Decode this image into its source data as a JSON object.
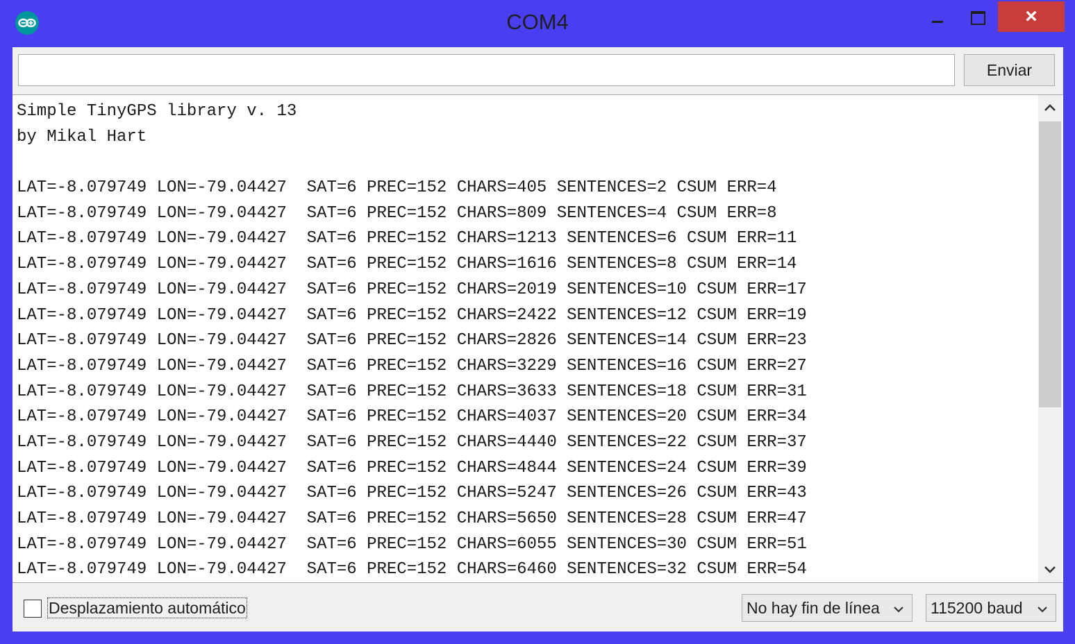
{
  "window": {
    "title": "COM4",
    "close_label": "×"
  },
  "toolbar": {
    "input_value": "",
    "send_label": "Enviar"
  },
  "console": {
    "lines": [
      "Simple TinyGPS library v. 13",
      "by Mikal Hart",
      "",
      "LAT=-8.079749 LON=-79.04427  SAT=6 PREC=152 CHARS=405 SENTENCES=2 CSUM ERR=4",
      "LAT=-8.079749 LON=-79.04427  SAT=6 PREC=152 CHARS=809 SENTENCES=4 CSUM ERR=8",
      "LAT=-8.079749 LON=-79.04427  SAT=6 PREC=152 CHARS=1213 SENTENCES=6 CSUM ERR=11",
      "LAT=-8.079749 LON=-79.04427  SAT=6 PREC=152 CHARS=1616 SENTENCES=8 CSUM ERR=14",
      "LAT=-8.079749 LON=-79.04427  SAT=6 PREC=152 CHARS=2019 SENTENCES=10 CSUM ERR=17",
      "LAT=-8.079749 LON=-79.04427  SAT=6 PREC=152 CHARS=2422 SENTENCES=12 CSUM ERR=19",
      "LAT=-8.079749 LON=-79.04427  SAT=6 PREC=152 CHARS=2826 SENTENCES=14 CSUM ERR=23",
      "LAT=-8.079749 LON=-79.04427  SAT=6 PREC=152 CHARS=3229 SENTENCES=16 CSUM ERR=27",
      "LAT=-8.079749 LON=-79.04427  SAT=6 PREC=152 CHARS=3633 SENTENCES=18 CSUM ERR=31",
      "LAT=-8.079749 LON=-79.04427  SAT=6 PREC=152 CHARS=4037 SENTENCES=20 CSUM ERR=34",
      "LAT=-8.079749 LON=-79.04427  SAT=6 PREC=152 CHARS=4440 SENTENCES=22 CSUM ERR=37",
      "LAT=-8.079749 LON=-79.04427  SAT=6 PREC=152 CHARS=4844 SENTENCES=24 CSUM ERR=39",
      "LAT=-8.079749 LON=-79.04427  SAT=6 PREC=152 CHARS=5247 SENTENCES=26 CSUM ERR=43",
      "LAT=-8.079749 LON=-79.04427  SAT=6 PREC=152 CHARS=5650 SENTENCES=28 CSUM ERR=47",
      "LAT=-8.079749 LON=-79.04427  SAT=6 PREC=152 CHARS=6055 SENTENCES=30 CSUM ERR=51",
      "LAT=-8.079749 LON=-79.04427  SAT=6 PREC=152 CHARS=6460 SENTENCES=32 CSUM ERR=54"
    ]
  },
  "footer": {
    "autoscroll_label": "Desplazamiento automático",
    "autoscroll_checked": false,
    "line_ending_selected": "No hay fin de línea",
    "baud_selected": "115200 baud"
  },
  "colors": {
    "frame": "#4a3ff0",
    "close_button": "#c93c3c",
    "arduino_teal": "#00979c"
  },
  "icons": {
    "app": "arduino-logo-icon",
    "minimize": "minimize-icon",
    "maximize": "maximize-icon",
    "close": "close-icon",
    "scroll_up": "chevron-up-icon",
    "scroll_down": "chevron-down-icon",
    "dropdown": "chevron-down-icon"
  }
}
